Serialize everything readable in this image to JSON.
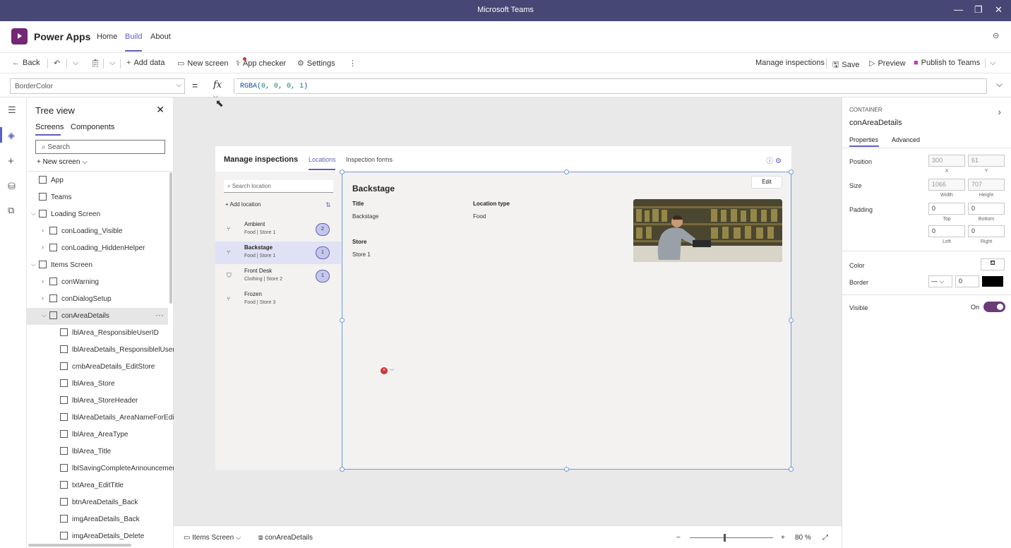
{
  "window": {
    "title": "Microsoft Teams"
  },
  "app": {
    "name": "Power Apps",
    "nav": [
      "Home",
      "Build",
      "About"
    ],
    "active_nav": "Build"
  },
  "commands": {
    "back": "Back",
    "add_data": "Add data",
    "new_screen": "New screen",
    "app_checker": "App checker",
    "settings": "Settings",
    "manage_inspections": "Manage inspections",
    "save": "Save",
    "preview": "Preview",
    "publish": "Publish to Teams"
  },
  "formula": {
    "property": "BorderColor",
    "fx": "fx",
    "expression_prefix": "RGBA(",
    "args": [
      "0",
      "0",
      "0",
      "1"
    ],
    "expression_suffix": ")"
  },
  "tree": {
    "title": "Tree view",
    "tabs": [
      "Screens",
      "Components"
    ],
    "search_placeholder": "Search",
    "new_screen": "New screen",
    "items": [
      {
        "label": "App",
        "indent": 0,
        "icon": "app-icon"
      },
      {
        "label": "Teams",
        "indent": 0,
        "icon": "teams-icon"
      },
      {
        "label": "Loading Screen",
        "indent": 0,
        "icon": "screen-icon",
        "caret": "v"
      },
      {
        "label": "conLoading_Visible",
        "indent": 1,
        "icon": "container-icon",
        "caret": ">"
      },
      {
        "label": "conLoading_HiddenHelper",
        "indent": 1,
        "icon": "container-icon",
        "caret": ">"
      },
      {
        "label": "Items Screen",
        "indent": 0,
        "icon": "screen-icon",
        "caret": "v"
      },
      {
        "label": "conWarning",
        "indent": 1,
        "icon": "container-icon",
        "caret": ">"
      },
      {
        "label": "conDialogSetup",
        "indent": 1,
        "icon": "container-icon",
        "caret": ">"
      },
      {
        "label": "conAreaDetails",
        "indent": 1,
        "icon": "container-icon",
        "caret": "v",
        "selected": true
      },
      {
        "label": "lblArea_ResponsibleUserID",
        "indent": 2,
        "icon": "label-icon"
      },
      {
        "label": "lblAreaDetails_ResponsiblelUserID",
        "indent": 2,
        "icon": "label-icon"
      },
      {
        "label": "cmbAreaDetails_EditStore",
        "indent": 2,
        "icon": "combobox-icon"
      },
      {
        "label": "lblArea_Store",
        "indent": 2,
        "icon": "label-icon"
      },
      {
        "label": "lblArea_StoreHeader",
        "indent": 2,
        "icon": "label-icon"
      },
      {
        "label": "lblAreaDetails_AreaNameForEdit",
        "indent": 2,
        "icon": "label-icon"
      },
      {
        "label": "lblArea_AreaType",
        "indent": 2,
        "icon": "label-icon"
      },
      {
        "label": "lblArea_Title",
        "indent": 2,
        "icon": "label-icon"
      },
      {
        "label": "lblSavingCompleteAnnouncement",
        "indent": 2,
        "icon": "label-icon"
      },
      {
        "label": "txtArea_EditTitle",
        "indent": 2,
        "icon": "textinput-icon"
      },
      {
        "label": "btnAreaDetails_Back",
        "indent": 2,
        "icon": "button-icon"
      },
      {
        "label": "imgAreaDetails_Back",
        "indent": 2,
        "icon": "image-icon"
      },
      {
        "label": "imgAreaDetails_Delete",
        "indent": 2,
        "icon": "image-icon"
      }
    ]
  },
  "appscreen": {
    "title": "Manage inspections",
    "tabs": [
      "Locations",
      "Inspection forms"
    ],
    "search_placeholder": "Search location",
    "add_location": "Add location",
    "locations": [
      {
        "name": "Ambient",
        "sub": "Food | Store 1",
        "count": "2",
        "icon": "fork-knife-icon"
      },
      {
        "name": "Backstage",
        "sub": "Food | Store 1",
        "count": "1",
        "icon": "fork-knife-icon",
        "selected": true
      },
      {
        "name": "Front Desk",
        "sub": "Clothing | Store 2",
        "count": "1",
        "icon": "shirt-icon"
      },
      {
        "name": "Frozen",
        "sub": "Food | Store 3",
        "count": "",
        "icon": "fork-knife-icon"
      }
    ],
    "details": {
      "heading": "Backstage",
      "edit": "Edit",
      "title_label": "Title",
      "title_value": "Backstage",
      "location_type_label": "Location type",
      "location_type_value": "Food",
      "store_label": "Store",
      "store_value": "Store 1"
    }
  },
  "statusbar": {
    "screen": "Items Screen",
    "control": "conAreaDetails",
    "zoom": "80",
    "zoom_unit": "%",
    "zoom_level": 0.8
  },
  "properties": {
    "kind": "CONTAINER",
    "name": "conAreaDetails",
    "tabs": [
      "Properties",
      "Advanced"
    ],
    "position_label": "Position",
    "x": "300",
    "y": "61",
    "x_cap": "X",
    "y_cap": "Y",
    "size_label": "Size",
    "width": "1066",
    "height": "707",
    "width_cap": "Width",
    "height_cap": "Height",
    "padding_label": "Padding",
    "pad_top": "0",
    "pad_bottom": "0",
    "pad_left": "0",
    "pad_right": "0",
    "top_cap": "Top",
    "bottom_cap": "Bottom",
    "left_cap": "Left",
    "right_cap": "Right",
    "color_label": "Color",
    "border_label": "Border",
    "border_width": "0",
    "border_color": "#000000",
    "visible_label": "Visible",
    "visible_state": "On"
  },
  "colors": {
    "teams_titlebar": "#464775",
    "accent": "#5b5fc7",
    "powerapps_brand": "#742774",
    "toggle_on": "#6b3b78"
  }
}
